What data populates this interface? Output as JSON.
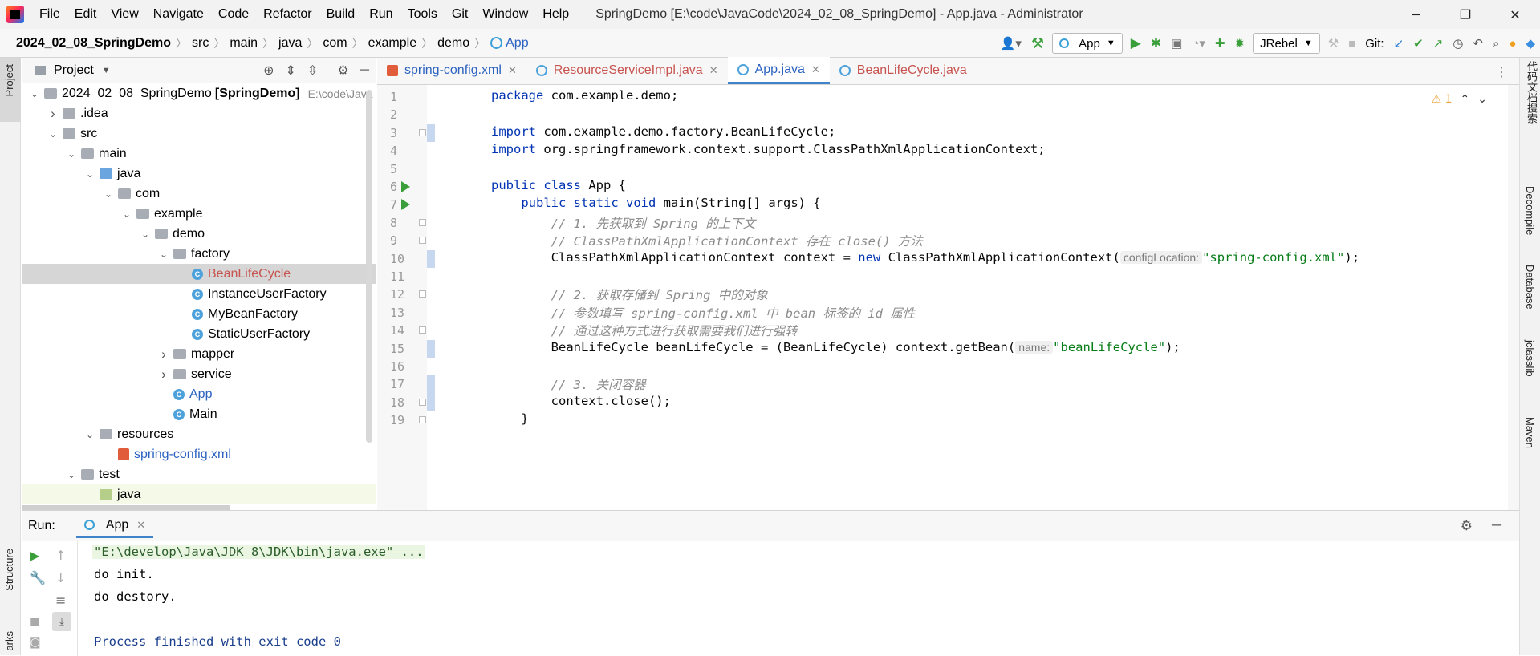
{
  "window": {
    "title": "SpringDemo [E:\\code\\JavaCode\\2024_02_08_SpringDemo] - App.java - Administrator",
    "menu": [
      "File",
      "Edit",
      "View",
      "Navigate",
      "Code",
      "Refactor",
      "Build",
      "Run",
      "Tools",
      "Git",
      "Window",
      "Help"
    ],
    "controls": {
      "minimize": "─",
      "restore": "❐",
      "close": "✕"
    }
  },
  "breadcrumb": [
    "2024_02_08_SpringDemo",
    "src",
    "main",
    "java",
    "com",
    "example",
    "demo",
    "App"
  ],
  "toolbar": {
    "run_config": "App",
    "jrebel": "JRebel",
    "git_label": "Git:"
  },
  "left_toolwindow": {
    "project_label": "Project",
    "structure_label": "Structure",
    "bookmarks_label": "arks"
  },
  "right_toolwindow": {
    "items": [
      "代码文档搜索",
      "Decompile",
      "Database",
      "jclasslib",
      "Maven"
    ]
  },
  "project": {
    "header": "Project",
    "tree": [
      {
        "label": "2024_02_08_SpringDemo",
        "suffix": "[SpringDemo]",
        "path": "E:\\code\\Java",
        "depth": 0,
        "arrow": "down",
        "icon": "folder"
      },
      {
        "label": ".idea",
        "depth": 1,
        "arrow": "right",
        "icon": "folder"
      },
      {
        "label": "src",
        "depth": 1,
        "arrow": "down",
        "icon": "folder"
      },
      {
        "label": "main",
        "depth": 2,
        "arrow": "down",
        "icon": "folder"
      },
      {
        "label": "java",
        "depth": 3,
        "arrow": "down",
        "icon": "folder-blue"
      },
      {
        "label": "com",
        "depth": 4,
        "arrow": "down",
        "icon": "package"
      },
      {
        "label": "example",
        "depth": 5,
        "arrow": "down",
        "icon": "package"
      },
      {
        "label": "demo",
        "depth": 6,
        "arrow": "down",
        "icon": "package"
      },
      {
        "label": "factory",
        "depth": 7,
        "arrow": "down",
        "icon": "package"
      },
      {
        "label": "BeanLifeCycle",
        "depth": 8,
        "arrow": "",
        "icon": "class",
        "selected": true,
        "color": "#c75450"
      },
      {
        "label": "InstanceUserFactory",
        "depth": 8,
        "arrow": "",
        "icon": "class"
      },
      {
        "label": "MyBeanFactory",
        "depth": 8,
        "arrow": "",
        "icon": "class"
      },
      {
        "label": "StaticUserFactory",
        "depth": 8,
        "arrow": "",
        "icon": "class"
      },
      {
        "label": "mapper",
        "depth": 7,
        "arrow": "right",
        "icon": "package"
      },
      {
        "label": "service",
        "depth": 7,
        "arrow": "right",
        "icon": "package"
      },
      {
        "label": "App",
        "depth": 7,
        "arrow": "",
        "icon": "class-run",
        "color": "#2b62c0"
      },
      {
        "label": "Main",
        "depth": 7,
        "arrow": "",
        "icon": "class-run"
      },
      {
        "label": "resources",
        "depth": 3,
        "arrow": "down",
        "icon": "folder-res"
      },
      {
        "label": "spring-config.xml",
        "depth": 4,
        "arrow": "",
        "icon": "xml",
        "color": "#2b62c0"
      },
      {
        "label": "test",
        "depth": 2,
        "arrow": "down",
        "icon": "folder"
      },
      {
        "label": "java",
        "depth": 3,
        "arrow": "",
        "icon": "folder-green",
        "highlight": true
      }
    ]
  },
  "tabs": [
    {
      "label": "spring-config.xml",
      "icon": "xml",
      "color": "#2b62c0"
    },
    {
      "label": "ResourceServiceImpl.java",
      "icon": "class",
      "color": "#c75450"
    },
    {
      "label": "App.java",
      "icon": "class",
      "color": "#2b62c0",
      "active": true
    },
    {
      "label": "BeanLifeCycle.java",
      "icon": "class",
      "color": "#c75450"
    }
  ],
  "editor": {
    "warnings": "⚠ 1",
    "line_numbers": [
      "1",
      "2",
      "3",
      "4",
      "5",
      "6",
      "7",
      "8",
      "9",
      "10",
      "11",
      "12",
      "13",
      "14",
      "15",
      "16",
      "17",
      "18",
      "19"
    ],
    "lines": [
      "package com.example.demo;",
      "",
      "import com.example.demo.factory.BeanLifeCycle;",
      "import org.springframework.context.support.ClassPathXmlApplicationContext;",
      "",
      "public class App {",
      "    public static void main(String[] args) {",
      "        // 1. 先获取到 Spring 的上下文",
      "        // ClassPathXmlApplicationContext 存在 close() 方法",
      "        ClassPathXmlApplicationContext context = new ClassPathXmlApplicationContext(",
      "",
      "        // 2. 获取存储到 Spring 中的对象",
      "        // 参数填写 spring-config.xml 中 bean 标签的 id 属性",
      "        // 通过这种方式进行获取需要我们进行强转",
      "        BeanLifeCycle beanLifeCycle = (BeanLifeCycle) context.getBean(",
      "",
      "        // 3. 关闭容器",
      "        context.close();",
      "    }"
    ],
    "hint_config": "configLocation:",
    "str_config": "\"spring-config.xml\"",
    "hint_name": "name:",
    "str_name": "\"beanLifeCycle\"",
    "tail": ");"
  },
  "run": {
    "label": "Run:",
    "tab": "App",
    "console": [
      "\"E:\\develop\\Java\\JDK 8\\JDK\\bin\\java.exe\" ...",
      "do init.",
      "do destory.",
      "",
      "Process finished with exit code 0"
    ]
  }
}
